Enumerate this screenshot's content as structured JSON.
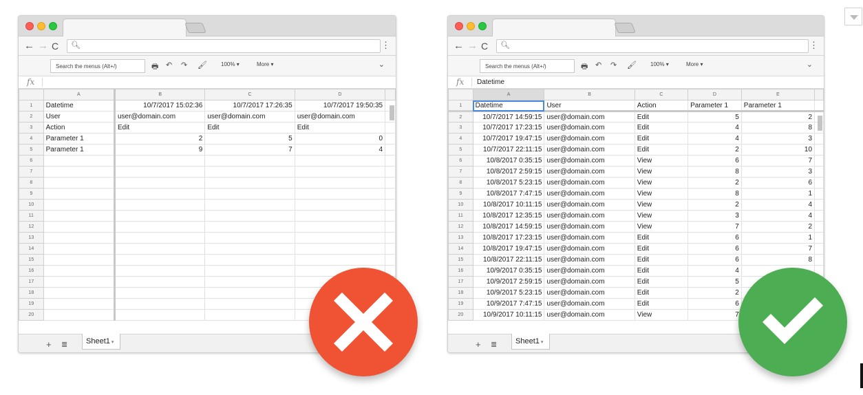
{
  "toolbar": {
    "search_placeholder": "Search the menus (Alt+/)",
    "zoom": "100%",
    "more": "More"
  },
  "formula": {
    "fx_label": "fx",
    "left_value": "",
    "right_value": "Datetime"
  },
  "sheet_tab": "Sheet1",
  "bad_example": {
    "columns": [
      "A",
      "B",
      "C",
      "D"
    ],
    "rows": [
      [
        "Datetime",
        "10/7/2017 15:02:36",
        "10/7/2017 17:26:35",
        "10/7/2017 19:50:35"
      ],
      [
        "User",
        "user@domain.com",
        "user@domain.com",
        "user@domain.com"
      ],
      [
        "Action",
        "Edit",
        "Edit",
        "Edit"
      ],
      [
        "Parameter 1",
        "2",
        "5",
        "0"
      ],
      [
        "Parameter 1",
        "9",
        "7",
        "4"
      ]
    ],
    "row_count": 20
  },
  "good_example": {
    "columns": [
      "A",
      "B",
      "C",
      "D",
      "E"
    ],
    "header": [
      "Datetime",
      "User",
      "Action",
      "Parameter 1",
      "Parameter 1"
    ],
    "rows": [
      [
        "10/7/2017 14:59:15",
        "user@domain.com",
        "Edit",
        "5",
        "2"
      ],
      [
        "10/7/2017 17:23:15",
        "user@domain.com",
        "Edit",
        "4",
        "8"
      ],
      [
        "10/7/2017 19:47:15",
        "user@domain.com",
        "Edit",
        "4",
        "3"
      ],
      [
        "10/7/2017 22:11:15",
        "user@domain.com",
        "Edit",
        "2",
        "10"
      ],
      [
        "10/8/2017 0:35:15",
        "user@domain.com",
        "View",
        "6",
        "7"
      ],
      [
        "10/8/2017 2:59:15",
        "user@domain.com",
        "View",
        "8",
        "3"
      ],
      [
        "10/8/2017 5:23:15",
        "user@domain.com",
        "View",
        "2",
        "6"
      ],
      [
        "10/8/2017 7:47:15",
        "user@domain.com",
        "View",
        "8",
        "1"
      ],
      [
        "10/8/2017 10:11:15",
        "user@domain.com",
        "View",
        "2",
        "4"
      ],
      [
        "10/8/2017 12:35:15",
        "user@domain.com",
        "View",
        "3",
        "4"
      ],
      [
        "10/8/2017 14:59:15",
        "user@domain.com",
        "View",
        "7",
        "2"
      ],
      [
        "10/8/2017 17:23:15",
        "user@domain.com",
        "Edit",
        "6",
        "1"
      ],
      [
        "10/8/2017 19:47:15",
        "user@domain.com",
        "Edit",
        "6",
        "7"
      ],
      [
        "10/8/2017 22:11:15",
        "user@domain.com",
        "Edit",
        "6",
        "8"
      ],
      [
        "10/9/2017 0:35:15",
        "user@domain.com",
        "Edit",
        "4",
        ""
      ],
      [
        "10/9/2017 2:59:15",
        "user@domain.com",
        "Edit",
        "5",
        ""
      ],
      [
        "10/9/2017 5:23:15",
        "user@domain.com",
        "Edit",
        "2",
        ""
      ],
      [
        "10/9/2017 7:47:15",
        "user@domain.com",
        "Edit",
        "6",
        ""
      ],
      [
        "10/9/2017 10:11:15",
        "user@domain.com",
        "View",
        "7",
        ""
      ]
    ]
  },
  "badges": {
    "bad_icon": "cross-icon",
    "good_icon": "check-icon",
    "bad_color": "#ef5334",
    "good_color": "#4cad52"
  }
}
